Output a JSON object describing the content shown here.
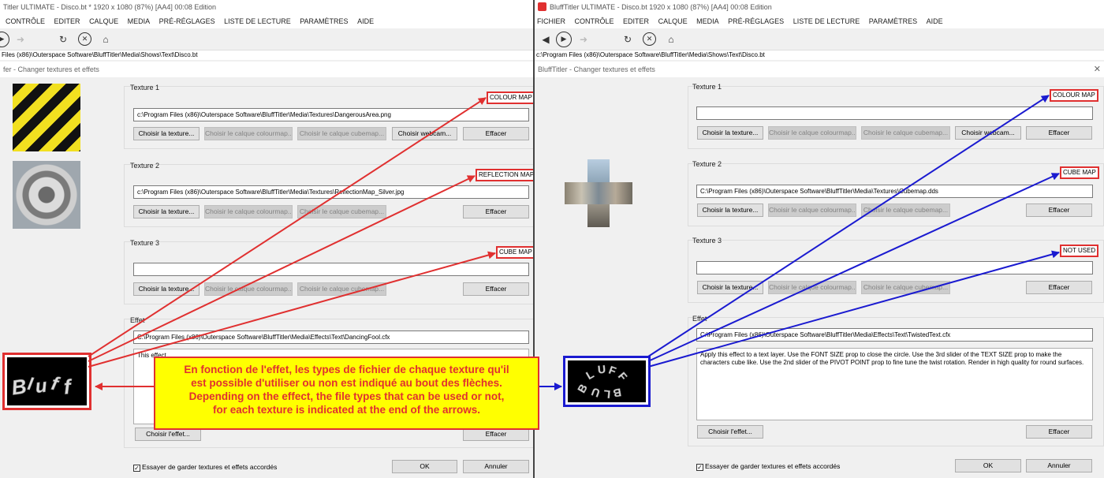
{
  "left": {
    "title": "Titler ULTIMATE  - Disco.bt * 1920 x 1080 (87%) [AA4] 00:08 Edition",
    "menu": [
      "CONTRÔLE",
      "EDITER",
      "CALQUE",
      "MEDIA",
      "PRÉ-RÉGLAGES",
      "LISTE DE LECTURE",
      "PARAMÈTRES",
      "AIDE"
    ],
    "path": "Files (x86)\\Outerspace Software\\BluffTitler\\Media\\Shows\\Text\\Disco.bt",
    "dialog_title": "fer - Changer textures et effets",
    "texture1": {
      "label": "Texture 1",
      "value": "c:\\Program Files (x86)\\Outerspace Software\\BluffTitler\\Media\\Textures\\DangerousArea.png",
      "buttons": [
        "Choisir la texture...",
        "Choisir le calque colourmap...",
        "Choisir le calque cubemap...",
        "Choisir webcam...",
        "Effacer"
      ],
      "tag": "COLOUR MAP"
    },
    "texture2": {
      "label": "Texture 2",
      "value": "c:\\Program Files (x86)\\Outerspace Software\\BluffTitler\\Media\\Textures\\ReflectionMap_Silver.jpg",
      "buttons": [
        "Choisir la texture...",
        "Choisir le calque colourmap...",
        "Choisir le calque cubemap...",
        "Effacer"
      ],
      "tag": "REFLECTION MAP"
    },
    "texture3": {
      "label": "Texture 3",
      "value": "",
      "buttons": [
        "Choisir la texture...",
        "Choisir le calque colourmap...",
        "Choisir le calque cubemap...",
        "Effacer"
      ],
      "tag": "CUBE MAP"
    },
    "effect": {
      "label": "Effet",
      "value": "C:\\Program Files (x86)\\Outerspace Software\\BluffTitler\\Media\\Effects\\Text\\DancingFool.cfx",
      "description": "This effect ...",
      "choose_label": "Choisir l'effet...",
      "clear_label": "Effacer"
    },
    "keep_label": "Essayer de garder textures et effets accordés",
    "ok_label": "OK",
    "cancel_label": "Annuler"
  },
  "right": {
    "title": "BluffTitler ULTIMATE  - Disco.bt 1920 x 1080 (87%) [AA4] 00:08 Edition",
    "menu": [
      "FICHIER",
      "CONTRÔLE",
      "EDITER",
      "CALQUE",
      "MEDIA",
      "PRÉ-RÉGLAGES",
      "LISTE DE LECTURE",
      "PARAMÈTRES",
      "AIDE"
    ],
    "path": "c:\\Program Files (x86)\\Outerspace Software\\BluffTitler\\Media\\Shows\\Text\\Disco.bt",
    "dialog_title": "BluffTitler - Changer textures et effets",
    "texture1": {
      "label": "Texture 1",
      "value": "",
      "buttons": [
        "Choisir la texture...",
        "Choisir le calque colourmap...",
        "Choisir le calque cubemap...",
        "Choisir webcam...",
        "Effacer"
      ],
      "tag": "COLOUR MAP"
    },
    "texture2": {
      "label": "Texture 2",
      "value": "C:\\Program Files (x86)\\Outerspace Software\\BluffTitler\\Media\\Textures\\Cubemap.dds",
      "buttons": [
        "Choisir la texture...",
        "Choisir le calque colourmap...",
        "Choisir le calque cubemap...",
        "Effacer"
      ],
      "tag": "CUBE MAP"
    },
    "texture3": {
      "label": "Texture 3",
      "value": "",
      "buttons": [
        "Choisir la texture...",
        "Choisir le calque colourmap...",
        "Choisir le calque cubemap...",
        "Effacer"
      ],
      "tag": "NOT USED"
    },
    "effect": {
      "label": "Effet",
      "value": "C:\\Program Files (x86)\\Outerspace Software\\BluffTitler\\Media\\Effects\\Text\\TwistedText.cfx",
      "description": "Apply this effect to a text layer. Use the FONT SIZE prop to close the circle. Use the 3rd slider of the TEXT SIZE prop to make the characters cube like. Use the 2nd slider of the PIVOT POINT prop to fine tune the twist rotation. Render in high quality for round surfaces.",
      "choose_label": "Choisir l'effet...",
      "clear_label": "Effacer"
    },
    "keep_label": "Essayer de garder textures et effets accordés",
    "ok_label": "OK",
    "cancel_label": "Annuler"
  },
  "callout": {
    "line1": "En fonction de l'effet, les types de fichier de chaque texture  qu'il",
    "line2": "est possible d'utiliser ou non est indiqué au bout des flèches.",
    "line3": "Depending on the effect, the file types that can be used or not,",
    "line4": "for each texture is indicated at the end of the arrows."
  },
  "icons": {
    "play": "play-icon",
    "back": "back-icon",
    "forward": "forward-icon",
    "refresh": "refresh-icon",
    "stop": "stop-icon",
    "home": "home-icon",
    "close": "close-icon"
  },
  "colors": {
    "left_arrows": "#e03030",
    "right_arrows": "#1a1ad0",
    "callout_bg": "#ffff00",
    "callout_text": "#e03030"
  }
}
